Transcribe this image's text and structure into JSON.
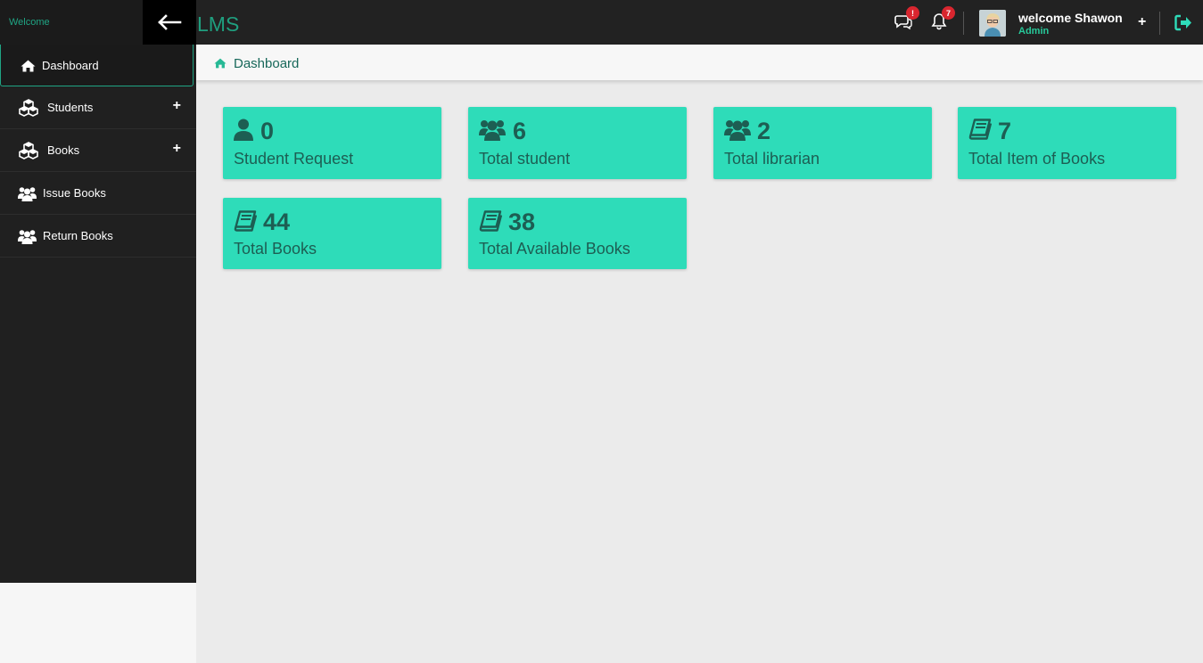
{
  "topbar": {
    "welcome_text": "Welcome",
    "app_title": "LMS",
    "messages_badge": "!",
    "notifications_badge": "7",
    "user_name": "welcome Shawon",
    "user_role": "Admin",
    "plus_symbol": "+"
  },
  "sidebar": {
    "items": [
      {
        "label": "Dashboard",
        "icon": "home-icon",
        "expandable": false
      },
      {
        "label": "Students",
        "icon": "cubes-icon",
        "expandable": true,
        "plus": "+"
      },
      {
        "label": "Books",
        "icon": "cubes-icon",
        "expandable": true,
        "plus": "+"
      },
      {
        "label": "Issue Books",
        "icon": "users-icon",
        "expandable": false
      },
      {
        "label": "Return Books",
        "icon": "users-icon",
        "expandable": false
      }
    ]
  },
  "breadcrumb": {
    "label": "Dashboard"
  },
  "cards": [
    {
      "value": "0",
      "label": "Student Request",
      "icon": "user-icon"
    },
    {
      "value": "6",
      "label": "Total student",
      "icon": "users-icon"
    },
    {
      "value": "2",
      "label": "Total librarian",
      "icon": "users-icon"
    },
    {
      "value": "7",
      "label": "Total Item of Books",
      "icon": "book-icon"
    },
    {
      "value": "44",
      "label": "Total Books",
      "icon": "book-icon"
    },
    {
      "value": "38",
      "label": "Total Available Books",
      "icon": "book-icon"
    }
  ],
  "colors": {
    "accent": "#2edcb9",
    "accent_dark": "#1d5e53",
    "brand_green": "#1f9f7f",
    "topbar_bg": "#222222",
    "sidebar_bg": "#202020",
    "badge_red": "#d9262f"
  }
}
